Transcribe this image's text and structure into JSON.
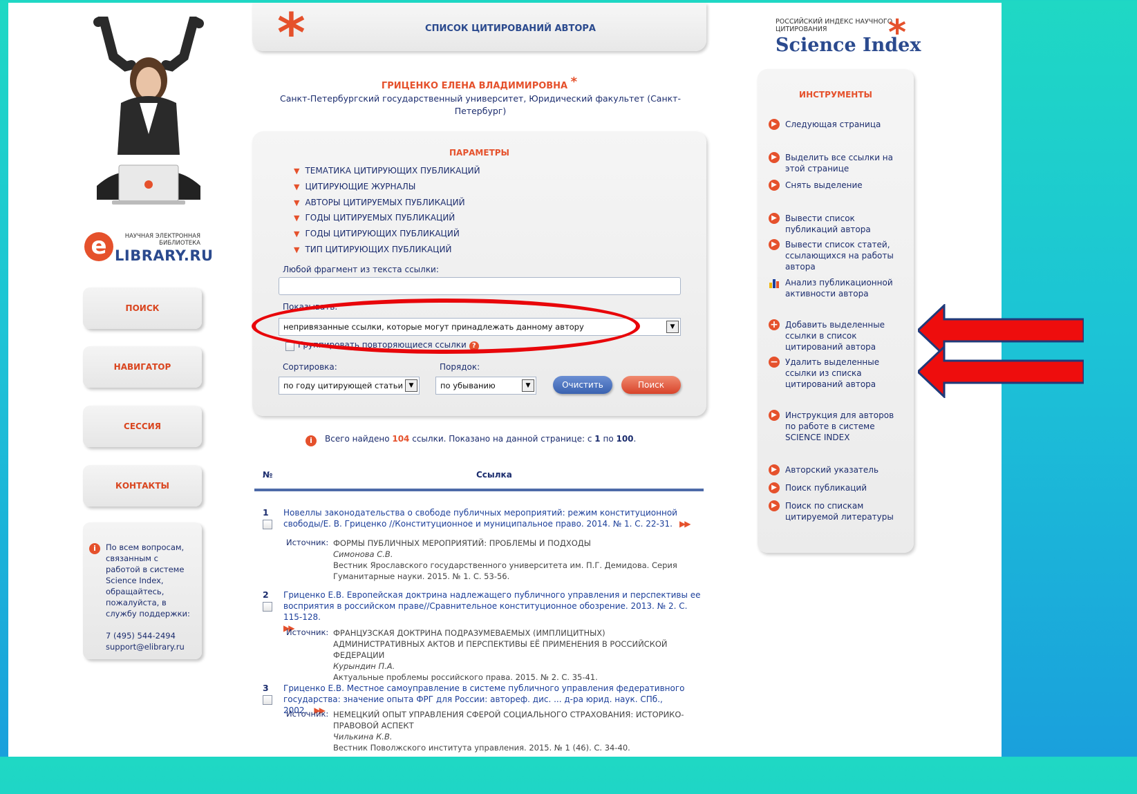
{
  "header": {
    "title": "СПИСОК ЦИТИРОВАНИЙ АВТОРА"
  },
  "brand": {
    "elibrary_small": "НАУЧНАЯ ЭЛЕКТРОННАЯ БИБЛИОТЕКА",
    "elibrary_main": "LIBRARY.RU",
    "elibrary_letter": "e",
    "sci_top": "РОССИЙСКИЙ ИНДЕКС НАУЧНОГО ЦИТИРОВАНИЯ",
    "sci_main": "Science Index"
  },
  "nav": {
    "search": "ПОИСК",
    "navigator": "НАВИГАТОР",
    "session": "СЕССИЯ",
    "contacts": "КОНТАКТЫ"
  },
  "support": {
    "text": "По всем вопросам, связанным с работой в системе Science Index, обращайтесь, пожалуйста, в службу поддержки:",
    "phone": "7 (495) 544-2494",
    "email": "support@elibrary.ru"
  },
  "author": {
    "name": "ГРИЦЕНКО ЕЛЕНА ВЛАДИМИРОВНА",
    "affiliation": "Санкт-Петербургский государственный университет, Юридический факультет (Санкт-Петербург)"
  },
  "params": {
    "title": "ПАРАМЕТРЫ",
    "filters": [
      "ТЕМАТИКА ЦИТИРУЮЩИХ ПУБЛИКАЦИЙ",
      "ЦИТИРУЮЩИЕ ЖУРНАЛЫ",
      "АВТОРЫ ЦИТИРУЕМЫХ ПУБЛИКАЦИЙ",
      "ГОДЫ ЦИТИРУЕМЫХ ПУБЛИКАЦИЙ",
      "ГОДЫ ЦИТИРУЮЩИХ ПУБЛИКАЦИЙ",
      "ТИП ЦИТИРУЮЩИХ ПУБЛИКАЦИЙ"
    ],
    "fragment_label": "Любой фрагмент из текста ссылки:",
    "fragment_value": "",
    "show_label": "Показывать:",
    "show_value": "непривязанные ссылки, которые могут принадлежать данному автору",
    "group_label": "Группировать повторяющиеся ссылки",
    "sort_label": "Сортировка:",
    "sort_value": "по году цитирующей статьи",
    "order_label": "Порядок:",
    "order_value": "по убыванию",
    "clear_button": "Очистить",
    "search_button": "Поиск"
  },
  "results": {
    "prefix": "Всего найдено ",
    "total": "104",
    "middle": " ссылки. Показано на данной странице: с ",
    "from": "1",
    "to_word": " по ",
    "to": "100",
    "suffix": "."
  },
  "table": {
    "col_no": "№",
    "col_ref": "Ссылка"
  },
  "entries": [
    {
      "num": "1",
      "ref": "Новеллы законодательства о свободе публичных мероприятий: режим конституционной свободы/Е. В. Гриценко //Конституционное и муниципальное право. 2014. № 1. С. 22-31.",
      "source_label": "Источник:",
      "source_title": "ФОРМЫ ПУБЛИЧНЫХ МЕРОПРИЯТИЙ: ПРОБЛЕМЫ И ПОДХОДЫ",
      "source_author": "Симонова С.В.",
      "source_journal": "Вестник Ярославского государственного университета им. П.Г. Демидова. Серия Гуманитарные науки. 2015. № 1. С. 53-56."
    },
    {
      "num": "2",
      "ref": "Гриценко Е.В. Европейская доктрина надлежащего публичного управления и перспективы ее восприятия в российском праве//Сравнительное конституционное обозрение. 2013. № 2. С. 115-128.",
      "source_label": "Источник:",
      "source_title": "ФРАНЦУЗСКАЯ ДОКТРИНА ПОДРАЗУМЕВАЕМЫХ (ИМПЛИЦИТНЫХ) АДМИНИСТРАТИВНЫХ АКТОВ И ПЕРСПЕКТИВЫ ЕЁ ПРИМЕНЕНИЯ В РОССИЙСКОЙ ФЕДЕРАЦИИ",
      "source_author": "Курындин П.А.",
      "source_journal": "Актуальные проблемы российского права. 2015. № 2. С. 35-41."
    },
    {
      "num": "3",
      "ref": "Гриценко Е.В. Местное самоуправление в системе публичного управления федеративного государства: значение опыта ФРГ для России: автореф. дис. ... д-ра юрид. наук. СПб., 2002.",
      "source_label": "Источник:",
      "source_title": "НЕМЕЦКИЙ ОПЫТ УПРАВЛЕНИЯ СФЕРОЙ СОЦИАЛЬНОГО СТРАХОВАНИЯ: ИСТОРИКО-ПРАВОВОЙ АСПЕКТ",
      "source_author": "Чилькина К.В.",
      "source_journal": "Вестник Поволжского института управления. 2015. № 1 (46). С. 34-40."
    }
  ],
  "tools": {
    "title": "ИНСТРУМЕНТЫ",
    "items": [
      {
        "label": "Следующая страница",
        "icon": "arrow-right-icon"
      },
      {
        "label": "Выделить все ссылки на этой странице",
        "icon": "arrow-right-icon"
      },
      {
        "label": "Снять выделение",
        "icon": "arrow-right-icon"
      },
      {
        "label": "Вывести список публикаций автора",
        "icon": "arrow-right-icon"
      },
      {
        "label": "Вывести список статей, ссылающихся на работы автора",
        "icon": "arrow-right-icon"
      },
      {
        "label": "Анализ публикационной активности автора",
        "icon": "bar-chart-icon"
      },
      {
        "label": "Добавить выделенные ссылки в список цитирований автора",
        "icon": "plus-icon"
      },
      {
        "label": "Удалить выделенные ссылки из списка цитирований автора",
        "icon": "minus-icon"
      },
      {
        "label": "Инструкция для авторов по работе в системе SCIENCE INDEX",
        "icon": "arrow-right-icon"
      },
      {
        "label": "Авторский указатель",
        "icon": "arrow-right-icon"
      },
      {
        "label": "Поиск публикаций",
        "icon": "arrow-right-icon"
      },
      {
        "label": "Поиск по спискам цитируемой литературы",
        "icon": "arrow-right-icon"
      }
    ]
  },
  "colors": {
    "accent": "#e5512c",
    "navy": "#1c2d6e",
    "link": "#1c3f9a",
    "highlight": "#e8060a"
  }
}
